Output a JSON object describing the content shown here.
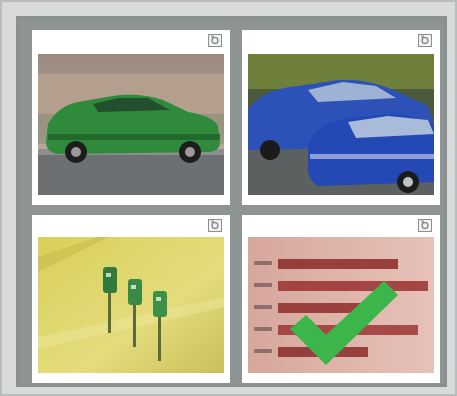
{
  "captcha": {
    "tiles": [
      {
        "image": "green-sedan",
        "zoom_icon": "zoom-icon",
        "selected": false
      },
      {
        "image": "blue-sedans",
        "zoom_icon": "zoom-icon",
        "selected": false
      },
      {
        "image": "green-mailboxes",
        "zoom_icon": "zoom-icon",
        "selected": false
      },
      {
        "image": "red-chart-with-checkmark",
        "zoom_icon": "zoom-icon",
        "selected": true
      }
    ],
    "colors": {
      "frame": "#d9dbdb",
      "grid": "#8e9393",
      "check": "#3cb54a"
    }
  }
}
